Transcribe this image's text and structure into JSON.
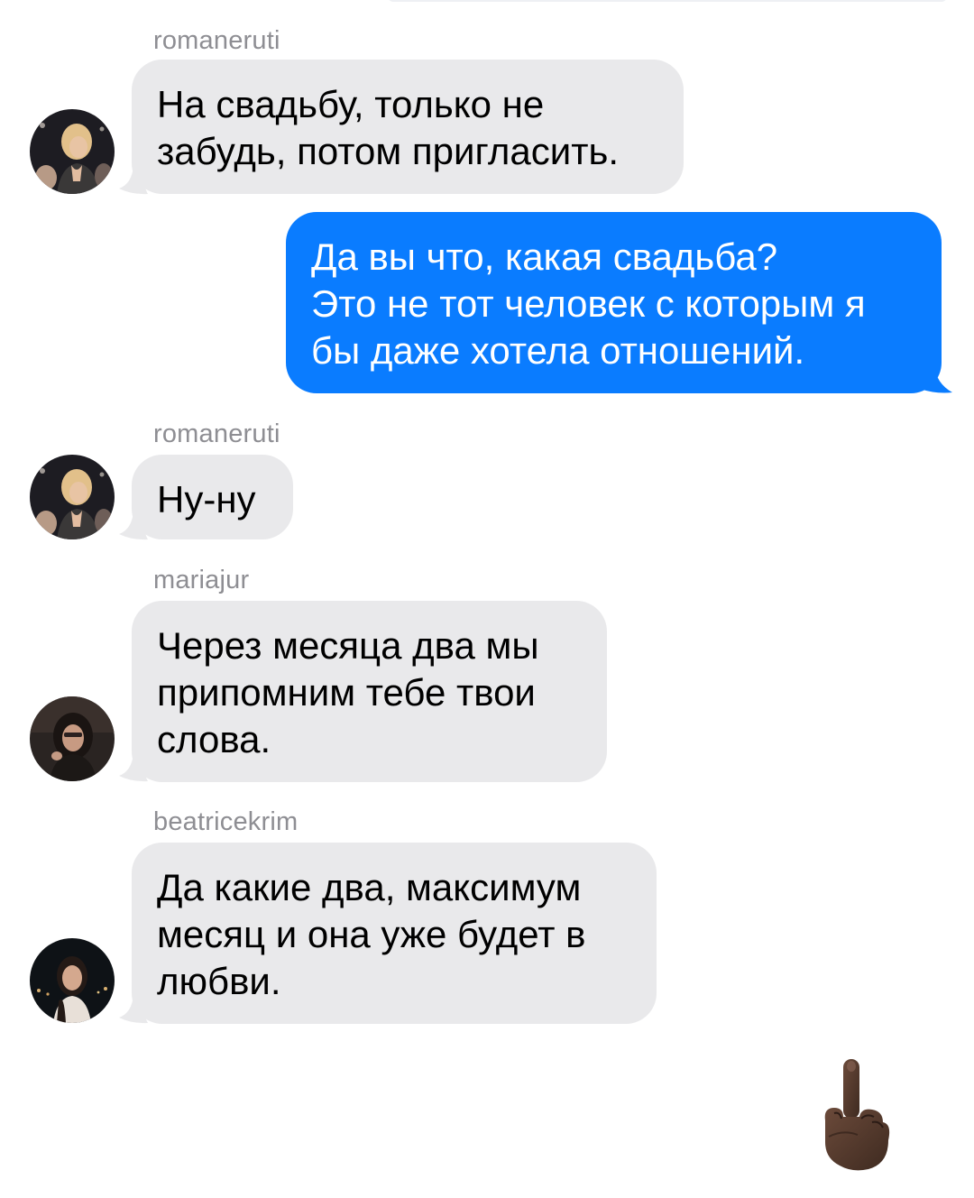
{
  "colors": {
    "incoming_bubble": "#e9e9eb",
    "outgoing_bubble": "#0a7cff",
    "sender_name": "#8e8e93"
  },
  "messages": [
    {
      "sender": "romaneruti",
      "direction": "incoming",
      "lines": [
        "На свадьбу, только не",
        "забудь, потом пригласить."
      ]
    },
    {
      "direction": "outgoing",
      "lines": [
        "Да вы что, какая свадьба?",
        "Это не тот человек с которым я",
        "бы даже хотела отношений."
      ]
    },
    {
      "sender": "romaneruti",
      "direction": "incoming",
      "lines": [
        "Ну-ну"
      ]
    },
    {
      "sender": "mariajur",
      "direction": "incoming",
      "lines": [
        "Через месяца два мы",
        "припомним тебе твои",
        "слова."
      ]
    },
    {
      "sender": "beatricekrim",
      "direction": "incoming",
      "lines": [
        "Да какие два, максимум",
        "месяц и она уже будет в",
        "любви."
      ]
    }
  ],
  "emoji": {
    "icon": "middle-finger-dark-skin-emoji"
  }
}
